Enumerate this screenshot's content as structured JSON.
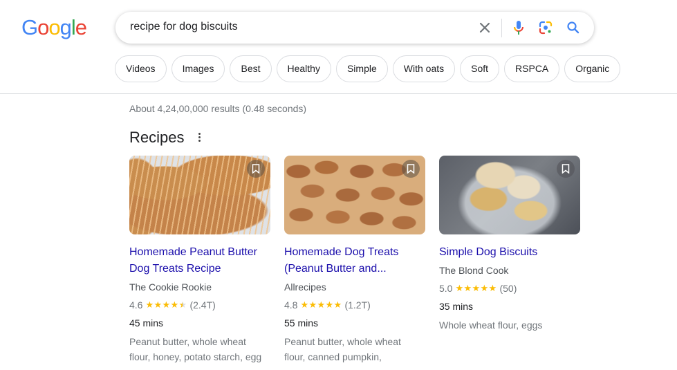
{
  "logo": {
    "letters": [
      "G",
      "o",
      "o",
      "g",
      "l",
      "e"
    ],
    "colors": [
      "#4285f4",
      "#ea4335",
      "#fbbc05",
      "#4285f4",
      "#34a853",
      "#ea4335"
    ]
  },
  "search": {
    "query": "recipe for dog biscuits",
    "icons": [
      "clear-icon",
      "microphone-icon",
      "lens-icon",
      "search-icon"
    ]
  },
  "chips": [
    "Videos",
    "Images",
    "Best",
    "Healthy",
    "Simple",
    "With oats",
    "Soft",
    "RSPCA",
    "Organic"
  ],
  "result_stats": "About 4,24,00,000 results (0.48 seconds)",
  "section": {
    "title": "Recipes"
  },
  "recipes": [
    {
      "title_line1": "Homemade Peanut Butter",
      "title_line2": "Dog Treats Recipe",
      "source": "The Cookie Rookie",
      "rating": "4.6",
      "stars": 4.5,
      "reviews": "(2.4T)",
      "time": "45 mins",
      "ingredients_line1": "Peanut butter, whole wheat",
      "ingredients_line2": "flour, honey, potato starch, egg"
    },
    {
      "title_line1": "Homemade Dog Treats",
      "title_line2": "(Peanut Butter and...",
      "source": "Allrecipes",
      "rating": "4.8",
      "stars": 5,
      "reviews": "(1.2T)",
      "time": "55 mins",
      "ingredients_line1": "Peanut butter, whole wheat",
      "ingredients_line2": "flour, canned pumpkin,"
    },
    {
      "title_line1": "Simple Dog Biscuits",
      "title_line2": "",
      "source": "The Blond Cook",
      "rating": "5.0",
      "stars": 5,
      "reviews": "(50)",
      "time": "35 mins",
      "ingredients_line1": "Whole wheat flour, eggs",
      "ingredients_line2": ""
    }
  ],
  "colors": {
    "link": "#1a0dab",
    "star": "#fbbc04",
    "muted": "#70757a",
    "border": "#dadce0"
  }
}
